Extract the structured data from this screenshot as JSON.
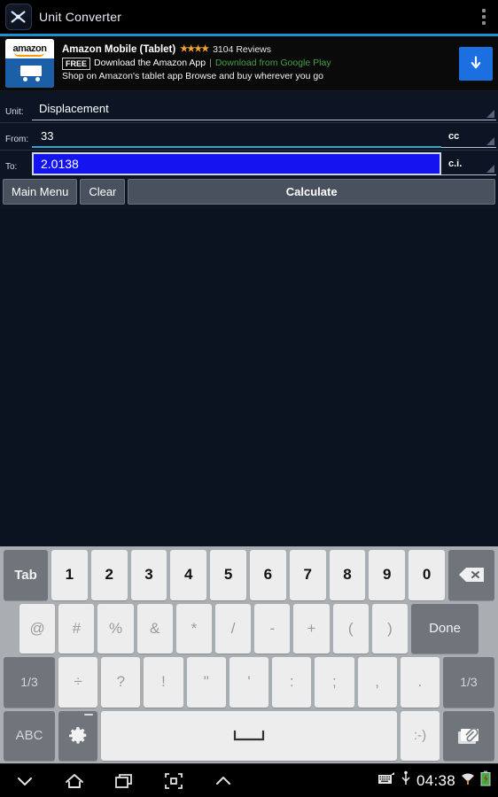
{
  "titlebar": {
    "app_name": "Unit Converter",
    "app_icon": "tools-icon",
    "overflow_icon": "overflow-menu-icon",
    "divider_color": "#1e8fd0"
  },
  "ad": {
    "icon": "amazon-icon",
    "brand_word": "amazon",
    "title": "Amazon Mobile (Tablet)",
    "stars": "★★★★",
    "star_count": 4,
    "reviews": "3104 Reviews",
    "free_badge": "FREE",
    "line2_text": "Download the Amazon App",
    "separator": "|",
    "google_play_link": "Download from Google Play",
    "description": "Shop on Amazon's tablet app Browse and buy wherever you go",
    "download_icon": "download-arrow-icon",
    "download_button_color": "#1b6fe0",
    "link_color": "#44a047"
  },
  "form": {
    "unit_label": "Unit:",
    "unit_value": "Displacement",
    "from_label": "From:",
    "from_value": "33",
    "from_unit": "cc",
    "to_label": "To:",
    "to_value": "2.0138",
    "to_unit": "c.i.",
    "to_field_bg": "#1414f0",
    "from_underline_color": "#2aa8c8",
    "spinner_icon": "spinner-triangle-icon"
  },
  "buttons": {
    "main_menu": "Main Menu",
    "clear": "Clear",
    "calculate": "Calculate"
  },
  "keyboard": {
    "row1": [
      "Tab",
      "1",
      "2",
      "3",
      "4",
      "5",
      "6",
      "7",
      "8",
      "9",
      "0"
    ],
    "backspace_icon": "backspace-icon",
    "row2": [
      "@",
      "#",
      "%",
      "&",
      "*",
      "/",
      "-",
      "+",
      "(",
      ")"
    ],
    "done": "Done",
    "row3_left": "1/3",
    "row3": [
      "÷",
      "?",
      "!",
      "\"",
      "'",
      ":",
      ";",
      ",",
      "."
    ],
    "row3_right": "1/3",
    "abc": "ABC",
    "gear_icon": "gear-icon",
    "space_icon": "space-bar-icon",
    "smiley": ":-)",
    "clip_icon": "attachment-icon"
  },
  "navbar": {
    "back_icon": "chevron-down-back-icon",
    "home_icon": "home-icon",
    "recents_icon": "recent-apps-icon",
    "screenshot_icon": "screenshot-icon",
    "expand_icon": "chevron-up-icon",
    "keyboard_status_icon": "keyboard-status-icon",
    "usb_icon": "usb-icon",
    "clock": "04:38",
    "wifi_icon": "wifi-icon",
    "battery_icon": "battery-icon"
  }
}
